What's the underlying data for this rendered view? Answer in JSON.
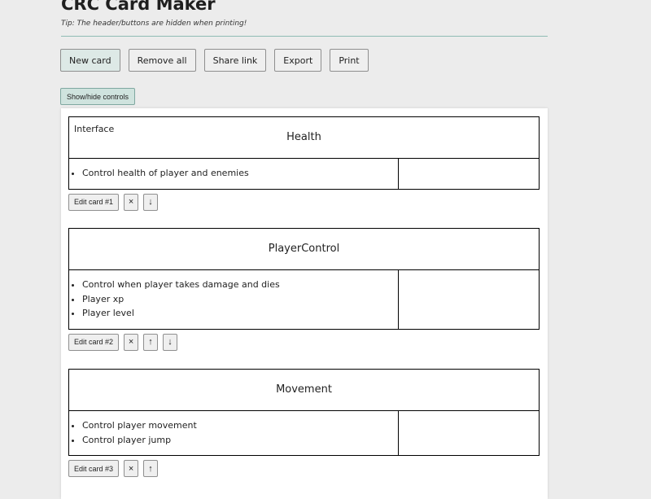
{
  "header": {
    "title": "CRC Card Maker",
    "tip": "Tip: The header/buttons are hidden when printing!"
  },
  "toolbar": {
    "new_card": "New card",
    "remove_all": "Remove all",
    "share_link": "Share link",
    "export": "Export",
    "print": "Print"
  },
  "toggle_controls": "Show/hide controls",
  "icons": {
    "close": "×",
    "up": "↑",
    "down": "↓"
  },
  "cards": [
    {
      "tag": "Interface",
      "name": "Health",
      "responsibilities": [
        "Control health of player and enemies"
      ],
      "edit_label": "Edit card #1"
    },
    {
      "tag": "",
      "name": "PlayerControl",
      "responsibilities": [
        "Control when player takes damage and dies",
        "Player xp",
        "Player level"
      ],
      "edit_label": "Edit card #2"
    },
    {
      "tag": "",
      "name": "Movement",
      "responsibilities": [
        "Control player movement",
        "Control player jump"
      ],
      "edit_label": "Edit card #3"
    }
  ]
}
